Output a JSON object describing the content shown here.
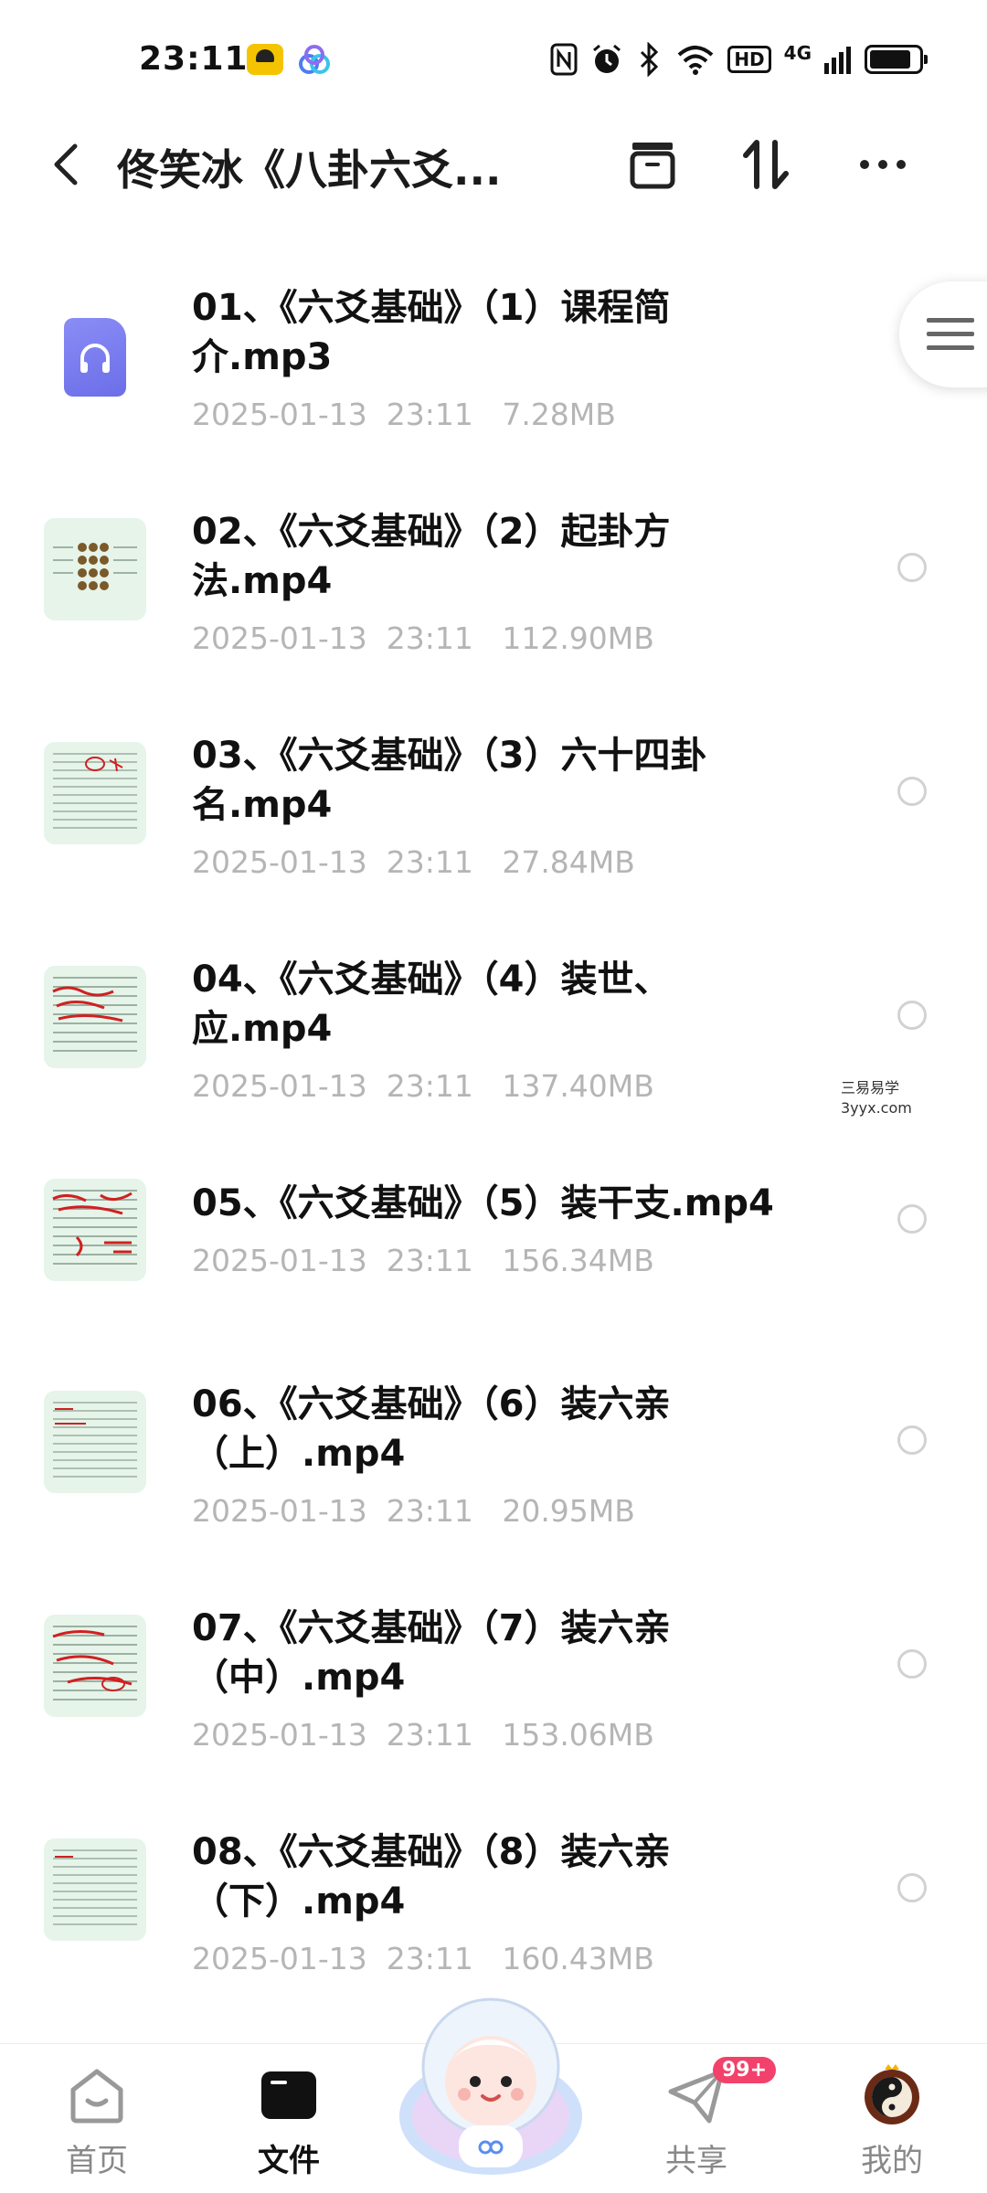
{
  "status_bar": {
    "time": "23:11",
    "icons": [
      "notification-app-icon",
      "cloud-app-icon",
      "nfc-icon",
      "alarm-icon",
      "bluetooth-icon",
      "wifi-icon"
    ],
    "hd_label": "HD",
    "network_label": "4G",
    "battery_icon": "battery-icon"
  },
  "title_bar": {
    "title": "佟笑冰《八卦六爻...",
    "back_icon": "back-arrow-icon",
    "archive_icon": "archive-icon",
    "sort_icon": "sort-icon",
    "more_icon": "more-icon"
  },
  "files": [
    {
      "line1": "01、《六爻基础》（1）课程简",
      "line2": "介.mp3",
      "meta": "2025-01-13  23:11   7.28MB",
      "type": "audio"
    },
    {
      "line1": "02、《六爻基础》（2）起卦方",
      "line2": "法.mp4",
      "meta": "2025-01-13  23:11   112.90MB",
      "type": "video"
    },
    {
      "line1": "03、《六爻基础》（3）六十四卦",
      "line2": "名.mp4",
      "meta": "2025-01-13  23:11   27.84MB",
      "type": "video"
    },
    {
      "line1": "04、《六爻基础》（4）装世、",
      "line2": "应.mp4",
      "meta": "2025-01-13  23:11   137.40MB",
      "type": "video"
    },
    {
      "line1": "05、《六爻基础》（5）装干支.mp4",
      "line2": "",
      "meta": "2025-01-13  23:11   156.34MB",
      "type": "video"
    },
    {
      "line1": "06、《六爻基础》（6）装六亲",
      "line2": "（上）.mp4",
      "meta": "2025-01-13  23:11   20.95MB",
      "type": "video"
    },
    {
      "line1": "07、《六爻基础》（7）装六亲",
      "line2": "（中）.mp4",
      "meta": "2025-01-13  23:11   153.06MB",
      "type": "video"
    },
    {
      "line1": "08、《六爻基础》（8）装六亲",
      "line2": "（下）.mp4",
      "meta": "2025-01-13  23:11   160.43MB",
      "type": "video"
    }
  ],
  "watermark": {
    "line1": "三易易学",
    "line2": "3yyx.com"
  },
  "bottom_nav": {
    "home": "首页",
    "files": "文件",
    "share": "共享",
    "share_badge": "99+",
    "mine": "我的",
    "active": "files"
  },
  "colors": {
    "accent": "#111111",
    "meta_text": "#b5b5b5",
    "thumb_bg": "#e6f4ea",
    "audio_icon": "#7275ee",
    "badge": "#f2416b"
  }
}
